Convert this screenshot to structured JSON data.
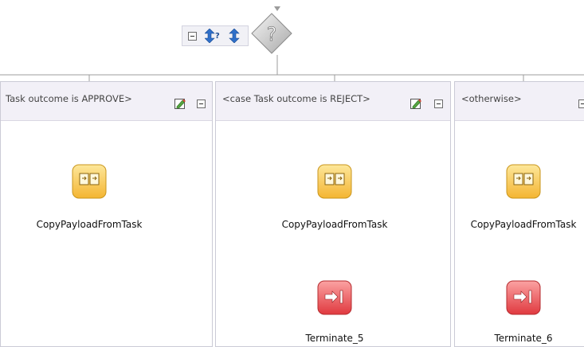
{
  "toolbar": {
    "collapse_icon": "collapse-icon",
    "expand_cases_icon": "expand-cases-icon",
    "sort_icon": "sort-arrows-icon"
  },
  "switch_node": {
    "icon": "switch-question-icon",
    "glyph": "?"
  },
  "cases": [
    {
      "label": "Task outcome is APPROVE>",
      "activities": [
        {
          "type": "assign",
          "icon": "copy-payload-icon",
          "label": "CopyPayloadFromTask"
        }
      ]
    },
    {
      "label": "<case Task outcome is REJECT>",
      "activities": [
        {
          "type": "assign",
          "icon": "copy-payload-icon",
          "label": "CopyPayloadFromTask"
        },
        {
          "type": "terminate",
          "icon": "terminate-icon",
          "label": "Terminate_5"
        }
      ]
    },
    {
      "label": "<otherwise>",
      "activities": [
        {
          "type": "assign",
          "icon": "copy-payload-icon",
          "label": "CopyPayloadFromTask"
        },
        {
          "type": "terminate",
          "icon": "terminate-icon",
          "label": "Terminate_6"
        }
      ]
    }
  ],
  "colors": {
    "assign_fill": "#f7c84a",
    "assign_border": "#c9961d",
    "terminate_fill": "#e8585e",
    "terminate_border": "#b52d31",
    "connector": "#9c9c9c",
    "lane_header": "#f2f0f7",
    "diamond": "#c8c8c8"
  }
}
